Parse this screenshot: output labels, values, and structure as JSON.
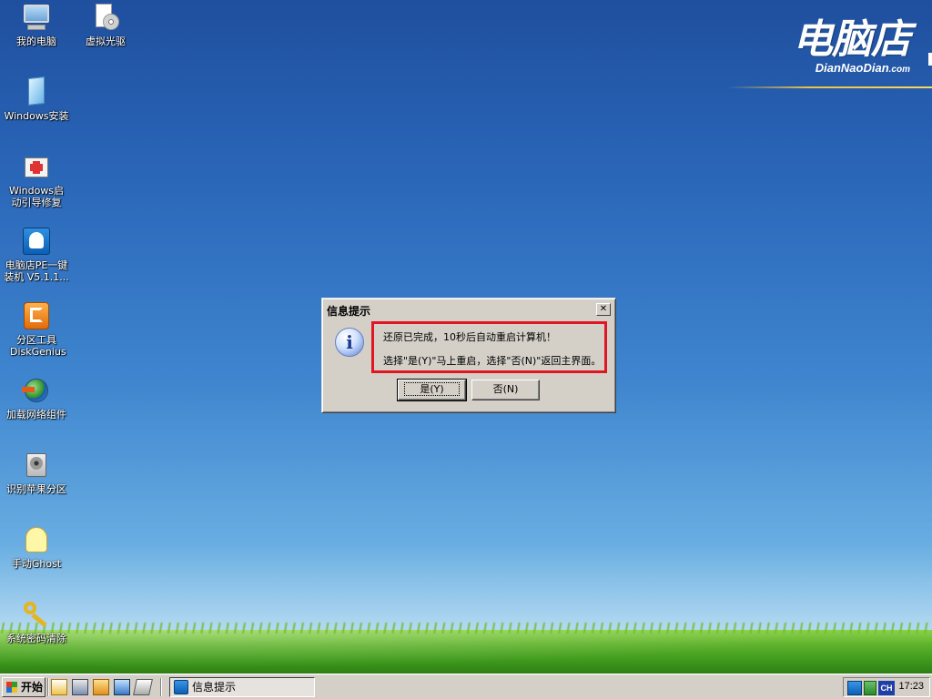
{
  "brand": {
    "name_cn": "电脑店",
    "name_en": "DianNaoDian",
    "name_en_suffix": ".com"
  },
  "desktop_icons": [
    {
      "label": "我的电脑",
      "icon": "computer-icon"
    },
    {
      "label": "虚拟光驱",
      "icon": "virtual-cd-icon"
    },
    {
      "label": "Windows安装",
      "icon": "windows-install-icon"
    },
    {
      "label": "Windows启动引导修复",
      "icon": "boot-repair-icon"
    },
    {
      "label": "电脑店PE一键装机 V5.1.1...",
      "icon": "pe-installer-icon"
    },
    {
      "label": "分区工具DiskGenius",
      "icon": "diskgenius-icon"
    },
    {
      "label": "加载网络组件",
      "icon": "network-icon"
    },
    {
      "label": "识别苹果分区",
      "icon": "harddisk-icon"
    },
    {
      "label": "手动Ghost",
      "icon": "ghost-icon"
    },
    {
      "label": "系统密码清除",
      "icon": "key-icon"
    }
  ],
  "dialog": {
    "title": "信息提示",
    "close_symbol": "✕",
    "message_line1": "还原已完成，10秒后自动重启计算机！",
    "message_line2": "选择\"是(Y)\"马上重启，选择\"否(N)\"返回主界面。",
    "yes_label": "是(Y)",
    "no_label": "否(N)",
    "highlight_color": "#e01623"
  },
  "taskbar": {
    "start_label": "开始",
    "quick_launch": [
      "explorer-icon",
      "printer-icon",
      "folder-icon",
      "display-icon",
      "eraser-icon"
    ],
    "active_task": "信息提示",
    "tray": {
      "ime": "CH",
      "clock": "17:23"
    }
  }
}
